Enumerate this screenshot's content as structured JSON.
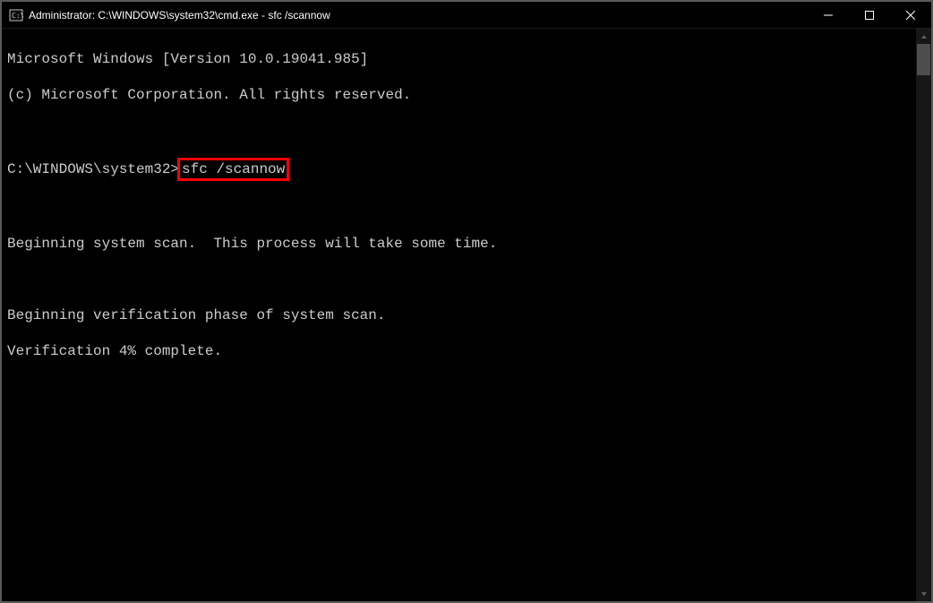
{
  "titlebar": {
    "text": "Administrator: C:\\WINDOWS\\system32\\cmd.exe - sfc  /scannow"
  },
  "console": {
    "line1": "Microsoft Windows [Version 10.0.19041.985]",
    "line2": "(c) Microsoft Corporation. All rights reserved.",
    "blank1": "",
    "prompt": "C:\\WINDOWS\\system32>",
    "command": "sfc /scannow",
    "blank2": "",
    "line3": "Beginning system scan.  This process will take some time.",
    "blank3": "",
    "line4": "Beginning verification phase of system scan.",
    "line5": "Verification 4% complete."
  }
}
